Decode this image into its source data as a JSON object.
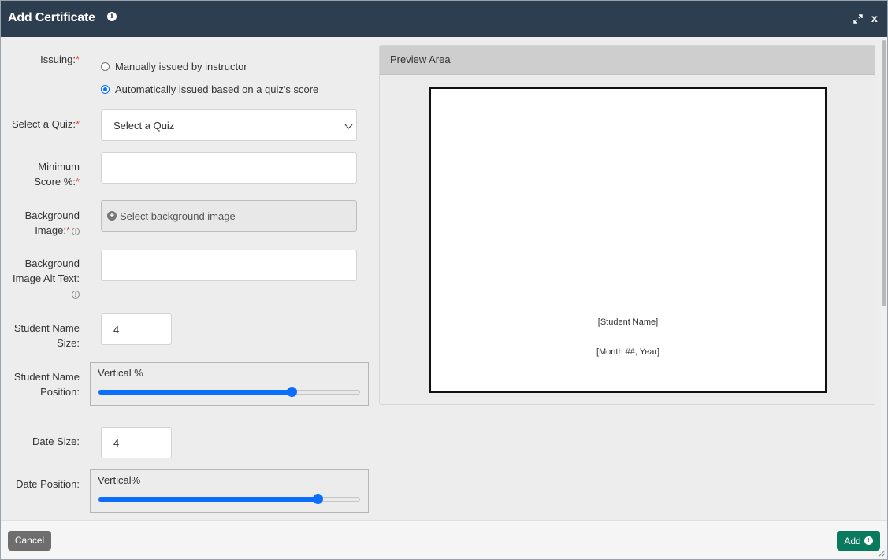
{
  "dialog": {
    "title": "Add Certificate",
    "close_label": "x"
  },
  "form": {
    "issuing_label": "Issuing:",
    "issuing_options": [
      {
        "label": "Manually issued by instructor",
        "checked": false
      },
      {
        "label": "Automatically issued based on a quiz's score",
        "checked": true
      }
    ],
    "quiz_label": "Select a Quiz:",
    "quiz_selected": "Select a Quiz",
    "min_score_label_1": "Minimum",
    "min_score_label_2": "Score %:",
    "min_score_value": "",
    "bg_image_label_1": "Background",
    "bg_image_label_2": "Image:",
    "bg_image_button": "Select background image",
    "alt_text_label_1": "Background",
    "alt_text_label_2": "Image Alt Text:",
    "alt_text_value": "",
    "student_name_size_label_1": "Student Name",
    "student_name_size_label_2": "Size:",
    "student_name_size_value": "4",
    "student_name_pos_label_1": "Student Name",
    "student_name_pos_label_2": "Position:",
    "student_name_slider_label": "Vertical %",
    "student_name_slider_value": 0.74,
    "date_size_label": "Date Size:",
    "date_size_value": "4",
    "date_pos_label": "Date Position:",
    "date_slider_label": "Vertical%",
    "date_slider_value": 0.84,
    "required_mark": "*"
  },
  "preview": {
    "header": "Preview Area",
    "student_name_placeholder": "[Student Name]",
    "date_placeholder": "[Month ##, Year]"
  },
  "footer": {
    "cancel_label": "Cancel",
    "add_label": "Add"
  },
  "colors": {
    "titlebar": "#2d3e50",
    "accent": "#0b6efd",
    "add_button": "#0a7a5f",
    "cancel_button": "#6e6e6e"
  }
}
